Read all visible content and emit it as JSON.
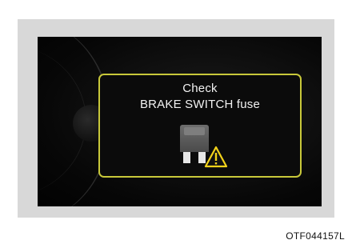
{
  "message": {
    "line1": "Check",
    "line2": "BRAKE SWITCH fuse"
  },
  "icons": {
    "fuse": "fuse-icon",
    "warning": "warning-triangle-icon"
  },
  "colors": {
    "panel_border": "#c8c83a",
    "warning_yellow": "#f2d21a",
    "text": "#f2f2f2",
    "screen_bg": "#070707"
  },
  "caption": "OTF044157L"
}
